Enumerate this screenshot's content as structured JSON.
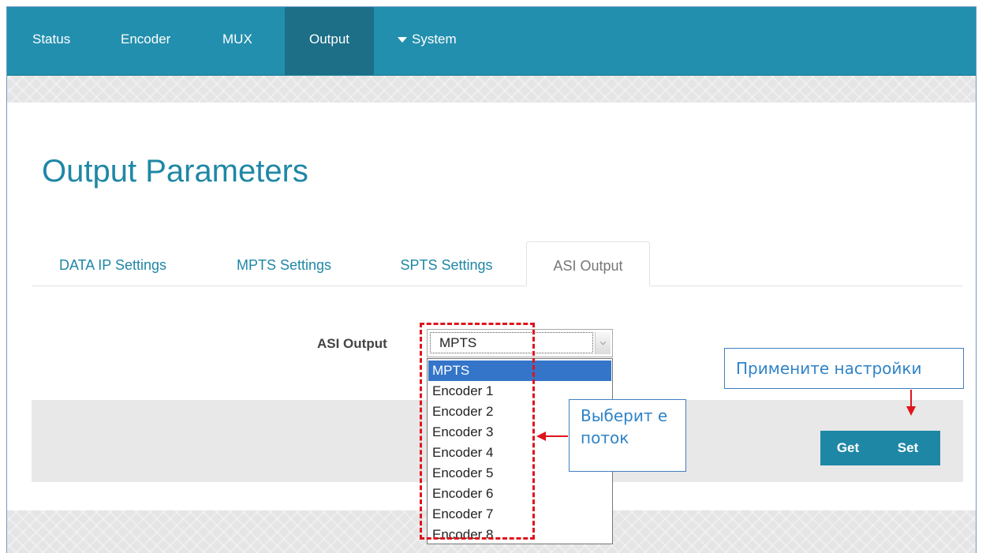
{
  "nav": {
    "items": [
      "Status",
      "Encoder",
      "MUX",
      "Output"
    ],
    "system_label": "System",
    "active": "Output"
  },
  "page_title": "Output Parameters",
  "tabs": [
    "DATA IP Settings",
    "MPTS Settings",
    "SPTS Settings",
    "ASI Output"
  ],
  "active_tab": "ASI Output",
  "form": {
    "asi_label": "ASI Output",
    "selected_value": "MPTS",
    "options": [
      "MPTS",
      "Encoder 1",
      "Encoder 2",
      "Encoder 3",
      "Encoder 4",
      "Encoder 5",
      "Encoder 6",
      "Encoder 7",
      "Encoder 8"
    ]
  },
  "buttons": {
    "get": "Get",
    "set": "Set"
  },
  "annotations": {
    "choose_stream": "Выберит е поток",
    "apply_settings": "Примените настройки",
    "color": "#e0141b"
  }
}
